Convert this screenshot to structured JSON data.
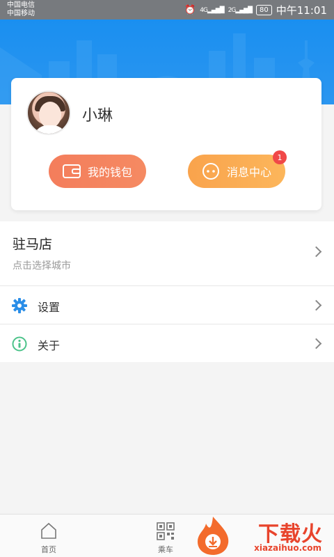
{
  "status_bar": {
    "carrier_1": "中国电信",
    "carrier_2": "中国移动",
    "signal_1": "4G",
    "signal_2": "2G",
    "battery": "80",
    "time": "中午11:01"
  },
  "profile": {
    "username": "小琳",
    "wallet_label": "我的钱包",
    "messages_label": "消息中心",
    "messages_badge": "1"
  },
  "city": {
    "name": "驻马店",
    "hint": "点击选择城市"
  },
  "menu": {
    "settings_label": "设置",
    "about_label": "关于"
  },
  "tabbar": {
    "home_label": "首页",
    "ride_label": "乘车"
  },
  "watermark": {
    "text": "下载火",
    "sub": "xiazaihuo.com"
  },
  "colors": {
    "header_blue": "#1a8ff0",
    "wallet_orange": "#f47d5c",
    "message_orange": "#fcb65b",
    "settings_icon_blue": "#2a8ee8",
    "about_icon_green": "#4cc38a",
    "badge_red": "#f04848"
  }
}
